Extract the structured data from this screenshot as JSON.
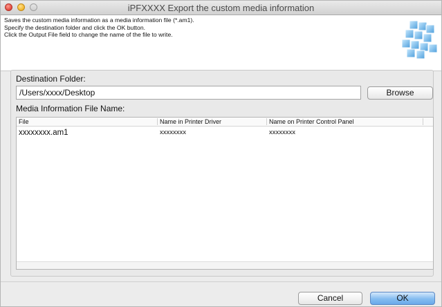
{
  "window": {
    "title": "iPFXXXX Export the custom media information"
  },
  "header": {
    "lines": [
      "Saves the custom media information as a media information file (*.am1).",
      "Specify the destination folder and click the OK button.",
      "Click the Output File field to change the name of the file to write."
    ],
    "logo_icon": "printer-blocks-logo"
  },
  "destination": {
    "label": "Destination Folder:",
    "value": "/Users/xxxx/Desktop",
    "browse_label": "Browse"
  },
  "media_file": {
    "label": "Media Information File Name:",
    "columns": [
      "File",
      "Name in Printer Driver",
      "Name on Printer Control Panel"
    ],
    "rows": [
      {
        "file": "xxxxxxxx.am1",
        "driver_name": "xxxxxxxx",
        "panel_name": "xxxxxxxx"
      }
    ]
  },
  "footer": {
    "cancel_label": "Cancel",
    "ok_label": "OK"
  },
  "colors": {
    "ok_button": "#84bcf0",
    "close_button": "#e0443a",
    "minimize_button": "#f2b52a",
    "logo_blue": "#3a9fe0"
  }
}
